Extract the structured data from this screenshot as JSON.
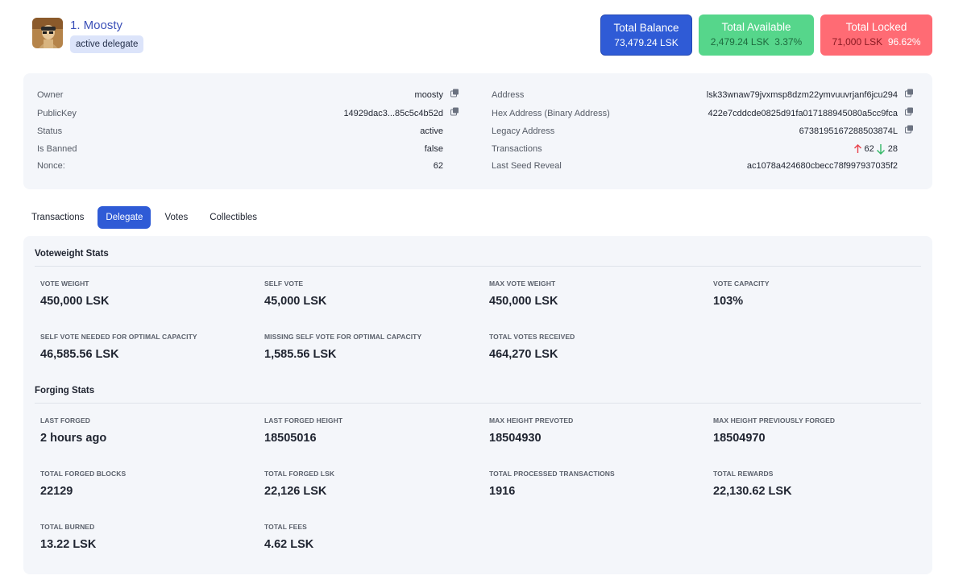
{
  "profile": {
    "name": "1. Moosty",
    "badge": "active delegate"
  },
  "balances": {
    "total_balance": {
      "title": "Total Balance",
      "value": "73,479.24 LSK"
    },
    "total_available": {
      "title": "Total Available",
      "value": "2,479.24 LSK",
      "percent": "3.37%"
    },
    "total_locked": {
      "title": "Total Locked",
      "value": "71,000 LSK",
      "percent": "96.62%"
    }
  },
  "info": {
    "left": [
      {
        "label": "Owner",
        "value": "moosty",
        "copy": true
      },
      {
        "label": "PublicKey",
        "value": "14929dac3...85c5c4b52d",
        "copy": true
      },
      {
        "label": "Status",
        "value": "active"
      },
      {
        "label": "Is Banned",
        "value": "false"
      },
      {
        "label": "Nonce:",
        "value": "62"
      }
    ],
    "right": [
      {
        "label": "Address",
        "value": "lsk33wnaw79jvxmsp8dzm22ymvuuvrjanf6jcu294",
        "copy": true
      },
      {
        "label": "Hex Address (Binary Address)",
        "value": "422e7cddcde0825d91fa017188945080a5cc9fca",
        "copy": true
      },
      {
        "label": "Legacy Address",
        "value": "6738195167288503874L",
        "copy": true
      },
      {
        "label": "Transactions",
        "sent": "62",
        "received": "28"
      },
      {
        "label": "Last Seed Reveal",
        "value": "ac1078a424680cbecc78f997937035f2"
      }
    ]
  },
  "tabs": [
    "Transactions",
    "Delegate",
    "Votes",
    "Collectibles"
  ],
  "active_tab": "Delegate",
  "voteweight": {
    "title": "Voteweight Stats",
    "stats": [
      {
        "label": "VOTE WEIGHT",
        "value": "450,000 LSK"
      },
      {
        "label": "SELF VOTE",
        "value": "45,000 LSK"
      },
      {
        "label": "MAX VOTE WEIGHT",
        "value": "450,000 LSK"
      },
      {
        "label": "VOTE CAPACITY",
        "value": "103%"
      },
      {
        "label": "SELF VOTE NEEDED FOR OPTIMAL CAPACITY",
        "value": "46,585.56 LSK"
      },
      {
        "label": "MISSING SELF VOTE FOR OPTIMAL CAPACITY",
        "value": "1,585.56 LSK"
      },
      {
        "label": "TOTAL VOTES RECEIVED",
        "value": "464,270 LSK"
      }
    ]
  },
  "forging": {
    "title": "Forging Stats",
    "stats": [
      {
        "label": "LAST FORGED",
        "value": "2 hours ago"
      },
      {
        "label": "LAST FORGED HEIGHT",
        "value": "18505016"
      },
      {
        "label": "MAX HEIGHT PREVOTED",
        "value": "18504930"
      },
      {
        "label": "MAX HEIGHT PREVIOUSLY FORGED",
        "value": "18504970"
      },
      {
        "label": "TOTAL FORGED BLOCKS",
        "value": "22129"
      },
      {
        "label": "TOTAL FORGED LSK",
        "value": "22,126 LSK"
      },
      {
        "label": "TOTAL PROCESSED TRANSACTIONS",
        "value": "1916"
      },
      {
        "label": "TOTAL REWARDS",
        "value": "22,130.62 LSK"
      },
      {
        "label": "TOTAL BURNED",
        "value": "13.22 LSK"
      },
      {
        "label": "TOTAL FEES",
        "value": "4.62 LSK"
      }
    ]
  },
  "colors": {
    "accent": "#2f5bd6",
    "available": "#56d68b",
    "locked": "#ff6b74",
    "arrow_up": "#e8414b",
    "arrow_down": "#33b866"
  },
  "icons": {
    "copy": "copy-icon",
    "arrow_up": "arrow-up-icon",
    "arrow_down": "arrow-down-icon"
  }
}
